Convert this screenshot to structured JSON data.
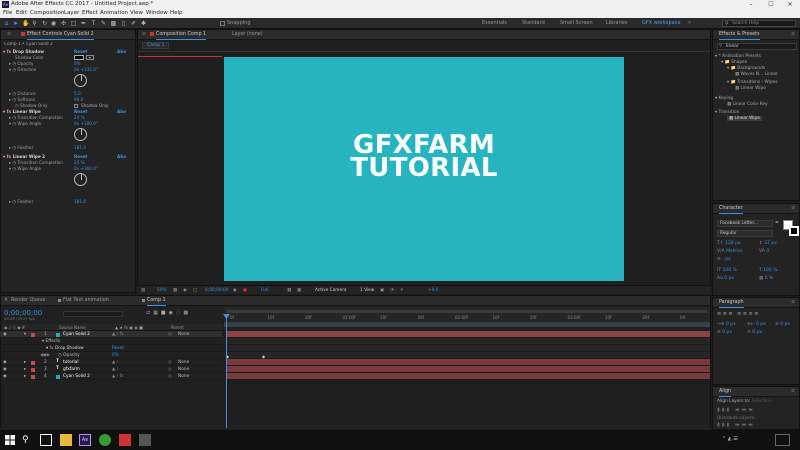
{
  "window": {
    "title": "Adobe After Effects CC 2017 - Untitled Project.aep *"
  },
  "menu": [
    "File",
    "Edit",
    "Composition",
    "Layer",
    "Effect",
    "Animation",
    "View",
    "Window",
    "Help"
  ],
  "toolbar": {
    "snapping": "Snapping",
    "workspaces": [
      "Essentials",
      "Standard",
      "Small Screen",
      "Libraries",
      "GFX workspace"
    ],
    "active_workspace": "GFX workspace",
    "search_placeholder": "Search Help"
  },
  "effect_controls": {
    "tab": "Effect Controls Cyan Solid 2",
    "header": "Comp 1 • Cyan Solid 2",
    "effects": [
      {
        "name": "Drop Shadow",
        "reset": "Reset",
        "about": "Abo",
        "props": [
          {
            "label": "Shadow Color",
            "value": ""
          },
          {
            "label": "Opacity",
            "value": "0%"
          },
          {
            "label": "Direction",
            "value": "0x +135.0°"
          },
          {
            "label": "Distance",
            "value": "5.0"
          },
          {
            "label": "Softness",
            "value": "90.0"
          },
          {
            "label": "Shadow Only",
            "value": "Shadow Only"
          }
        ]
      },
      {
        "name": "Linear Wipe",
        "reset": "Reset",
        "about": "Abo",
        "props": [
          {
            "label": "Transition Completion",
            "value": "24 %"
          },
          {
            "label": "Wipe Angle",
            "value": "0x +180.0°"
          },
          {
            "label": "Feather",
            "value": "181.0"
          }
        ]
      },
      {
        "name": "Linear Wipe 2",
        "reset": "Reset",
        "about": "Abo",
        "props": [
          {
            "label": "Transition Completion",
            "value": "24 %"
          },
          {
            "label": "Wipe Angle",
            "value": "0x +360.0°"
          },
          {
            "label": "Feather",
            "value": "181.0"
          }
        ]
      }
    ]
  },
  "composition": {
    "tab": "Composition Comp 1",
    "layer_tab": "Layer (none)",
    "comp_label": "Comp 1",
    "title_line1": "GFXFARM",
    "title_line2": "TUTORIAL",
    "canvas_color": "#25b4c0",
    "footer": {
      "zoom": "50%",
      "timecode": "0;00;00;00",
      "resolution": "Full",
      "camera": "Active Camera",
      "views": "1 View",
      "offset": "+0.0"
    }
  },
  "timeline": {
    "tabs": [
      "Render Queue",
      "Flat Text animation",
      "Comp 1"
    ],
    "timecode": "0;00;00;00",
    "timecode_sub": "00000 (29.97 fps)",
    "columns": {
      "source_name": "Source Name",
      "parent": "Parent"
    },
    "layers": [
      {
        "num": "1",
        "name": "Cyan Solid 2",
        "color": "#22aabb",
        "parent": "None"
      },
      {
        "num": "2",
        "name": "tutorial",
        "color": "#c84b4b",
        "parent": "None"
      },
      {
        "num": "3",
        "name": "gfxfarm",
        "color": "#c84b4b",
        "parent": "None"
      },
      {
        "num": "4",
        "name": "Cyan Solid 2",
        "color": "#22aabb",
        "parent": "None"
      }
    ],
    "sublayers": [
      {
        "label": "Effects"
      },
      {
        "label": "Drop Shadow",
        "value": "Reset"
      },
      {
        "label": "Opacity",
        "value": "0%"
      }
    ],
    "ruler": [
      "0f",
      "10f",
      "20f",
      "01:00f",
      "10f",
      "20f",
      "02:00f",
      "10f",
      "20f",
      "03:00f",
      "10f",
      "20f",
      "04"
    ],
    "footer": "Toggle Switches / Modes"
  },
  "effects_presets": {
    "tab": "Effects & Presets",
    "search": "linear",
    "tree": [
      {
        "label": "* Animation Presets",
        "indent": 0
      },
      {
        "label": "Shapes",
        "indent": 1
      },
      {
        "label": "Backgrounds",
        "indent": 2
      },
      {
        "label": "Waves N... Linear",
        "indent": 3
      },
      {
        "label": "Transitions - Wipes",
        "indent": 2
      },
      {
        "label": "Linear Wipe",
        "indent": 3
      },
      {
        "label": "Keying",
        "indent": 0
      },
      {
        "label": "Linear Color Key",
        "indent": 1
      },
      {
        "label": "Transition",
        "indent": 0
      },
      {
        "label": "Linear Wipe",
        "indent": 1,
        "selected": true
      }
    ]
  },
  "character": {
    "tab": "Character",
    "font": "Facebook Letter...",
    "style": "Regular",
    "size": "128 px",
    "leading": "37 px",
    "kerning": "Metrics",
    "tracking": "0",
    "stroke_unit": "- px",
    "vscale": "100 %",
    "hscale": "100 %",
    "baseline": "0 px",
    "tsume": "0 %"
  },
  "paragraph": {
    "tab": "Paragraph",
    "values": [
      "0 px",
      "0 px",
      "0 px",
      "0 px",
      "0 px"
    ]
  },
  "align": {
    "tab": "Align",
    "align_to_label": "Align Layers to:",
    "align_to_value": "Selection",
    "distribute": "Distribute Layers:"
  },
  "taskbar": {
    "time": "",
    "icons": [
      "windows-logo",
      "search",
      "task-view",
      "file-explorer",
      "after-effects",
      "chrome",
      "app",
      "app"
    ]
  }
}
